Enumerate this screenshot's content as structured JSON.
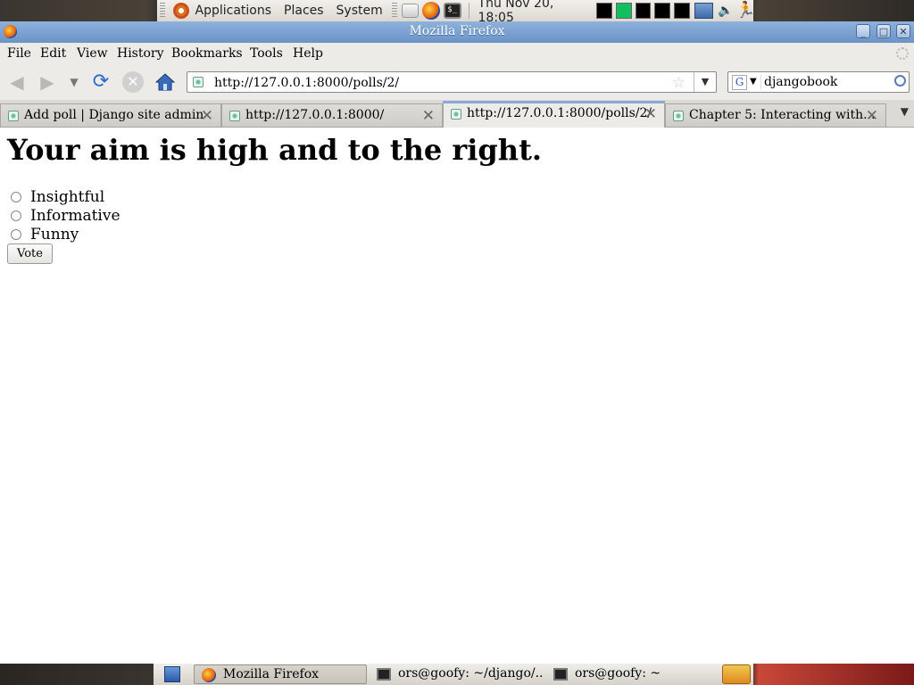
{
  "top_panel": {
    "menus": [
      "Applications",
      "Places",
      "System"
    ],
    "clock": "Thu Nov 20, 18:05",
    "launcher_icons": [
      "mail-icon",
      "firefox-icon",
      "terminal-icon"
    ],
    "terminal_glyph": "$_"
  },
  "window": {
    "title": "Mozilla Firefox",
    "controls": [
      "minimize",
      "maximize",
      "close"
    ]
  },
  "menubar": [
    "File",
    "Edit",
    "View",
    "History",
    "Bookmarks",
    "Tools",
    "Help"
  ],
  "navigation": {
    "url": "http://127.0.0.1:8000/polls/2/",
    "search_engine": "Google",
    "search_engine_glyph": "G",
    "search_value": "djangobook"
  },
  "tabs": [
    {
      "label": "Add poll | Django site admin",
      "active": false
    },
    {
      "label": "http://127.0.0.1:8000/",
      "active": false
    },
    {
      "label": "http://127.0.0.1:8000/polls/2/",
      "active": true
    },
    {
      "label": "Chapter 5: Interacting with...",
      "active": false
    }
  ],
  "page": {
    "heading": "Your aim is high and to the right.",
    "choices": [
      "Insightful",
      "Informative",
      "Funny"
    ],
    "vote_label": "Vote"
  },
  "taskbar": {
    "tasks": [
      {
        "label": "Mozilla Firefox",
        "icon": "firefox-icon",
        "active": true
      },
      {
        "label": "ors@goofy: ~/django/...",
        "icon": "terminal-icon",
        "active": false
      },
      {
        "label": "ors@goofy: ~",
        "icon": "terminal-icon",
        "active": false
      }
    ]
  }
}
